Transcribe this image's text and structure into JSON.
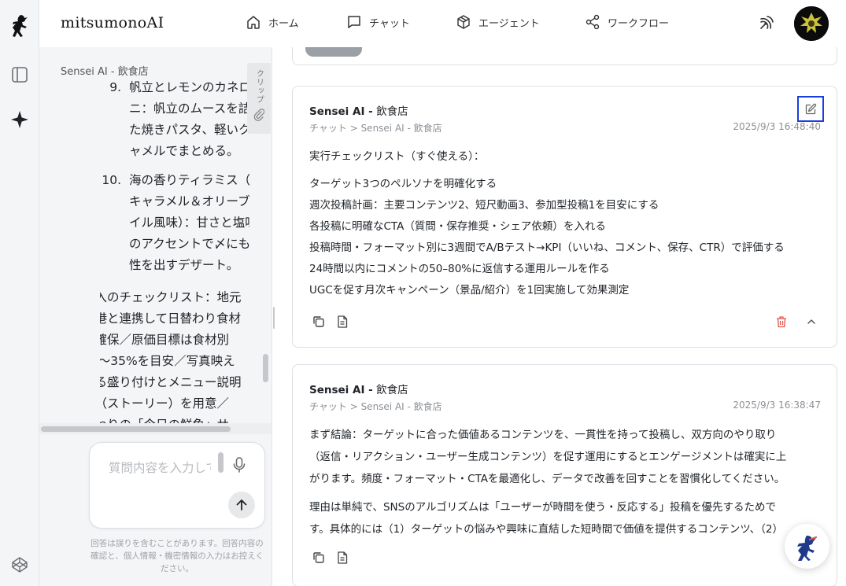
{
  "app": {
    "name": "mitsumonoAI"
  },
  "nav": [
    {
      "label": "ホーム",
      "icon": "home-icon"
    },
    {
      "label": "チャット",
      "icon": "chat-icon"
    },
    {
      "label": "エージェント",
      "icon": "cube-icon"
    },
    {
      "label": "ワークフロー",
      "icon": "share-icon"
    }
  ],
  "left_panel": {
    "title": "Sensei AI - 飲食店",
    "clip_label": "クリップ",
    "list": [
      {
        "num": "9.",
        "lines": [
          "帆立とレモンのカネロ",
          "ニ：帆立のムースを詰",
          "た焼きパスタ、軽いク",
          "ャメルでまとめる。"
        ]
      },
      {
        "num": "10.",
        "lines": [
          "海の香りティラミス（塩",
          "キャラメル＆オリーブオ",
          "イル風味）：甘さと塩味",
          "のアクセントで〆にも個",
          "性を出すデザート。"
        ]
      }
    ],
    "paragraph_lines": [
      "導入のチェックリスト：地元",
      "漁港と連携して日替わり食材",
      "を確保／原価目標は食材別",
      "30〜35%を目安／写真映え",
      "する盛り付けとメニュー説明",
      "文（ストーリー）を用意／",
      "甘わりの「今日の鮮魚」サ"
    ],
    "input_placeholder": "質問内容を入力してください",
    "disclaimer": "回答は誤りを含むことがあります。回答内容の確認と、個人情報・機密情報の入力はお控えください。"
  },
  "cards": [
    {
      "title_bold": "Sensei AI -",
      "title_rest": " 飲食店",
      "breadcrumb": "チャット > Sensei AI - 飲食店",
      "timestamp": "2025/9/3 16:48:40",
      "lines": [
        "実行チェックリスト（すぐ使える）：",
        "ターゲット3つのペルソナを明確化する",
        "週次投稿計画：主要コンテンツ2、短尺動画3、参加型投稿1を目安にする",
        "各投稿に明確なCTA（質問・保存推奨・シェア依頼）を入れる",
        "投稿時間・フォーマット別に3週間でA/Bテスト→KPI（いいね、コメント、保存、CTR）で評価する",
        "24時間以内にコメントの50–80%に返信する運用ルールを作る",
        "UGCを促す月次キャンペーン（景品/紹介）を1回実施して効果測定"
      ]
    },
    {
      "title_bold": "Sensei AI -",
      "title_rest": " 飲食店",
      "breadcrumb": "チャット > Sensei AI - 飲食店",
      "timestamp": "2025/9/3 16:38:47",
      "lines": [
        "まず結論：ターゲットに合った価値あるコンテンツを、一貫性を持って投稿し、双方向のやり取り",
        "（返信・リアクション・ユーザー生成コンテンツ）を促す運用にするとエンゲージメントは確実に上",
        "がります。頻度・フォーマット・CTAを最適化し、データで改善を回すことを習慣化してください。",
        "理由は単純で、SNSのアルゴリズムは「ユーザーが時間を使う・反応する」投稿を優先するためで",
        "す。具体的には（1）ターゲットの悩みや興味に直結した短時間で価値を提供するコンテンツ、（2）"
      ]
    }
  ],
  "colors": {
    "accent": "#1a3fe0",
    "delete": "#e5534b",
    "panel_bg": "#f4f5f7"
  }
}
